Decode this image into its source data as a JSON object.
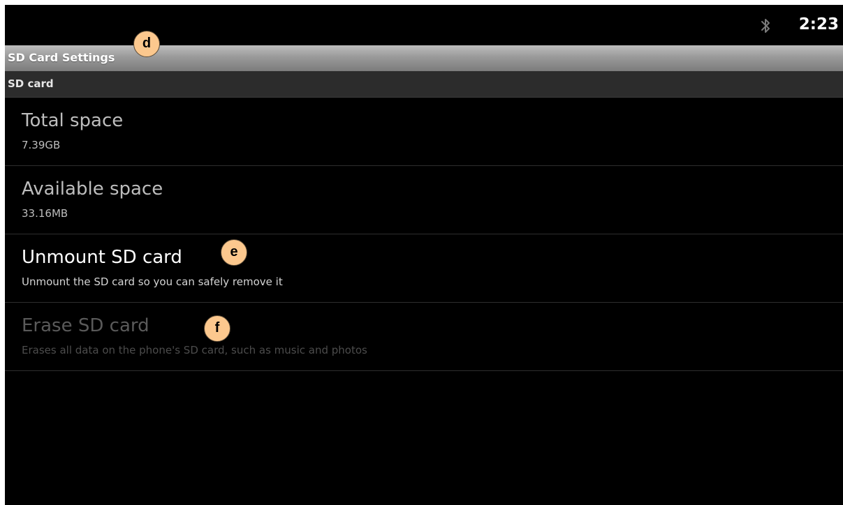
{
  "status_bar": {
    "icons": [
      "bluetooth-icon"
    ],
    "time": "2:23"
  },
  "title_bar": {
    "title": "SD Card Settings"
  },
  "section": {
    "header": "SD card"
  },
  "preferences": [
    {
      "title": "Total space",
      "summary": "7.39GB",
      "enabled": true
    },
    {
      "title": "Available space",
      "summary": "33.16MB",
      "enabled": true
    },
    {
      "title": "Unmount SD card",
      "summary": "Unmount the SD card so you can safely remove it",
      "enabled": true
    },
    {
      "title": "Erase SD card",
      "summary": "Erases all data on the phone's SD card, such as music and photos",
      "enabled": false
    }
  ],
  "annotations": [
    "d",
    "e",
    "f"
  ],
  "colors": {
    "marker_fill": "#fcc88e",
    "title_bar_gradient_top": "#bdbdbd",
    "title_bar_gradient_bottom": "#7c7c7c",
    "section_header_bg": "#2c2c2c"
  }
}
